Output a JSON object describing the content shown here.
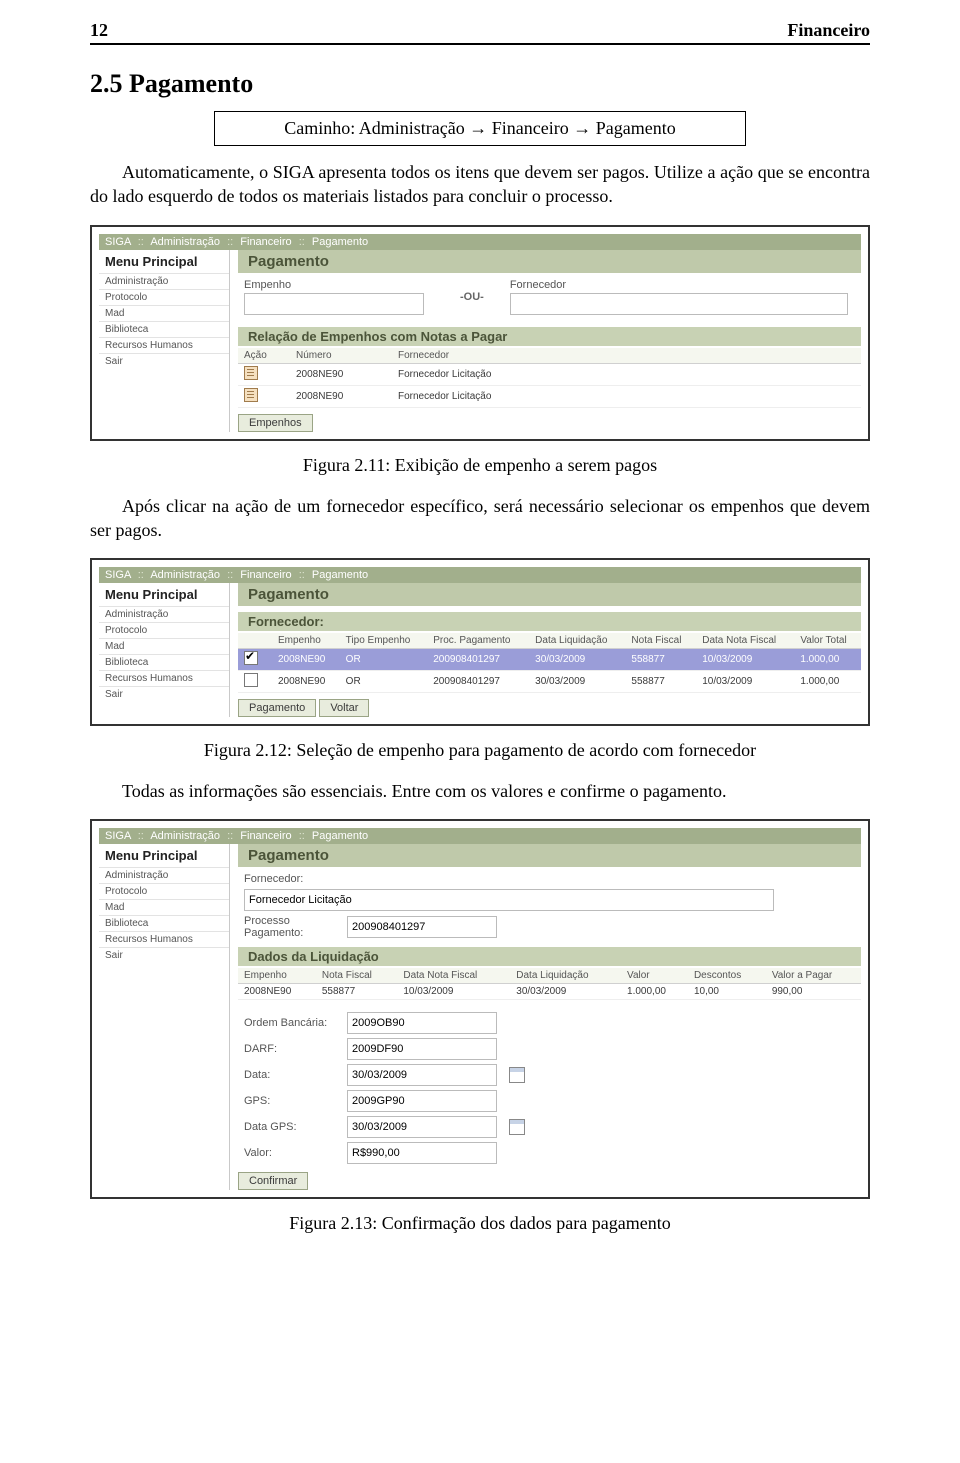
{
  "page_header": {
    "num": "12",
    "title": "Financeiro"
  },
  "section": "2.5  Pagamento",
  "caminho": "Caminho: Administração → Financeiro → Pagamento",
  "para1": "Automaticamente, o SIGA apresenta todos os itens que devem ser pagos. Utilize a ação que se encontra do lado esquerdo de todos os materiais listados para concluir o processo.",
  "para2": "Após clicar na ação de um fornecedor específico, será necessário selecionar os empenhos que devem ser pagos.",
  "para3": "Todas as informações são essenciais. Entre com os valores e confirme o pagamento.",
  "captions": {
    "c1": "Figura 2.11: Exibição de empenho a serem pagos",
    "c2": "Figura 2.12: Seleção de empenho para pagamento de acordo com fornecedor",
    "c3": "Figura 2.13: Confirmação dos dados para pagamento"
  },
  "crumbs": {
    "app": "SIGA",
    "items": [
      "Administração",
      "Financeiro",
      "Pagamento"
    ]
  },
  "sidebar": {
    "title": "Menu Principal",
    "items": [
      "Administração",
      "Protocolo",
      "Mad",
      "Biblioteca",
      "Recursos Humanos",
      "Sair"
    ]
  },
  "fig1": {
    "title": "Pagamento",
    "lbl_empenho": "Empenho",
    "lbl_fornecedor": "Fornecedor",
    "ou": "-OU-",
    "sub": "Relação de Empenhos com Notas a Pagar",
    "th": [
      "Ação",
      "Número",
      "Fornecedor"
    ],
    "rows": [
      {
        "numero": "2008NE90",
        "forn": "Fornecedor Licitação"
      },
      {
        "numero": "2008NE90",
        "forn": "Fornecedor Licitação"
      }
    ],
    "btn": "Empenhos"
  },
  "fig2": {
    "title": "Pagamento",
    "sub": "Fornecedor:",
    "th": [
      "",
      "Empenho",
      "Tipo Empenho",
      "Proc. Pagamento",
      "Data Liquidação",
      "Nota Fiscal",
      "Data Nota Fiscal",
      "Valor Total"
    ],
    "rows": [
      {
        "sel": true,
        "empenho": "2008NE90",
        "tipo": "OR",
        "proc": "200908401297",
        "dliq": "30/03/2009",
        "nf": "558877",
        "dnf": "10/03/2009",
        "valor": "1.000,00"
      },
      {
        "sel": false,
        "empenho": "2008NE90",
        "tipo": "OR",
        "proc": "200908401297",
        "dliq": "30/03/2009",
        "nf": "558877",
        "dnf": "10/03/2009",
        "valor": "1.000,00"
      }
    ],
    "btn1": "Pagamento",
    "btn2": "Voltar"
  },
  "fig3": {
    "title": "Pagamento",
    "lbl_forn": "Fornecedor:",
    "val_forn": "Fornecedor Licitação",
    "lbl_proc": "Processo Pagamento:",
    "val_proc": "200908401297",
    "sub": "Dados da Liquidação",
    "th": [
      "Empenho",
      "Nota Fiscal",
      "Data Nota Fiscal",
      "Data Liquidação",
      "Valor",
      "Descontos",
      "Valor a Pagar"
    ],
    "row": {
      "empenho": "2008NE90",
      "nf": "558877",
      "dnf": "10/03/2009",
      "dliq": "30/03/2009",
      "valor": "1.000,00",
      "desc": "10,00",
      "pagar": "990,00"
    },
    "fields": {
      "ob_l": "Ordem Bancária:",
      "ob_v": "2009OB90",
      "darf_l": "DARF:",
      "darf_v": "2009DF90",
      "data_l": "Data:",
      "data_v": "30/03/2009",
      "gps_l": "GPS:",
      "gps_v": "2009GP90",
      "dgps_l": "Data GPS:",
      "dgps_v": "30/03/2009",
      "val_l": "Valor:",
      "val_v": "R$990,00"
    },
    "btn": "Confirmar"
  }
}
